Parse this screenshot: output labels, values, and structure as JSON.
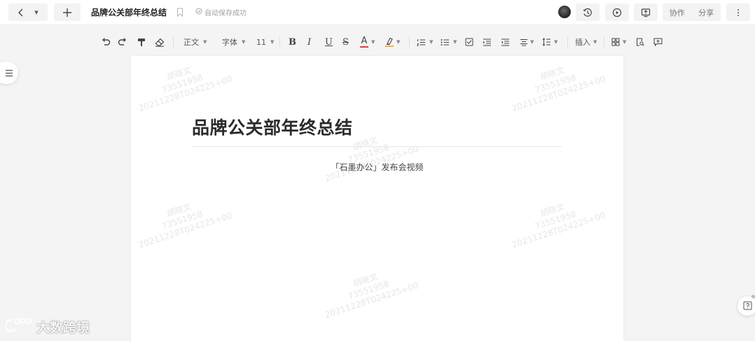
{
  "topbar": {
    "doc_title": "品牌公关部年终总结",
    "autosave_text": "自动保存成功",
    "collab_label": "协作",
    "share_label": "分享"
  },
  "toolbar": {
    "paragraph_style": "正文",
    "font_family": "字体",
    "font_size": "11",
    "bold": "B",
    "italic": "I",
    "underline": "U",
    "strikethrough": "S",
    "font_color_label": "A",
    "insert_label": "插入",
    "font_color": "#e33b3b",
    "highlight_color": "#f5b13d"
  },
  "document": {
    "heading": "品牌公关部年终总结",
    "paragraph": "「石墨办公」发布会视频"
  },
  "watermark": {
    "name": "胡晓文",
    "id": "73551958",
    "timestamp": "20211228T024225+00"
  },
  "brand": {
    "text": "大数跨境"
  }
}
